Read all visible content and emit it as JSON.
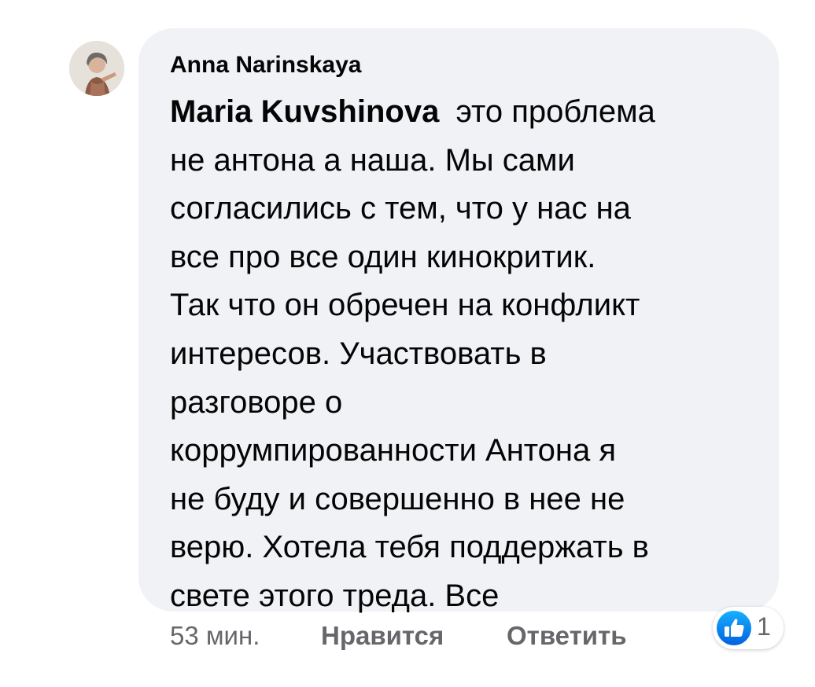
{
  "comment": {
    "author": "Anna Narinskaya",
    "mention": "Maria Kuvshinova",
    "lines": [
      "это проблема",
      "не антона а наша. Мы сами",
      "согласились с тем, что у нас на",
      "все про все один кинокритик.",
      "Так что он обречен на конфликт",
      "интересов. Участвовать в",
      "разговоре о",
      "коррумпированности Антона я",
      "не буду и совершенно в нее не",
      "верю. Хотела тебя поддержать в",
      "свете этого треда. Все"
    ]
  },
  "actions": {
    "timestamp": "53 мин.",
    "like_label": "Нравится",
    "reply_label": "Ответить"
  },
  "reactions": {
    "icon": "like-icon",
    "count": "1"
  },
  "colors": {
    "bubble": "#f0f2f5",
    "text": "#050505",
    "secondary": "#65676b",
    "like_blue": "#1877f2"
  }
}
